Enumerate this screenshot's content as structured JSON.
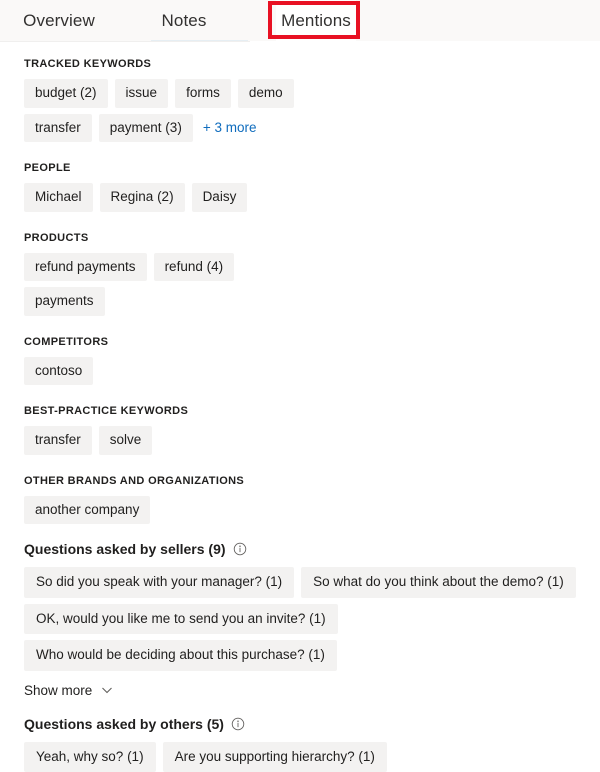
{
  "tabs": [
    {
      "label": "Overview",
      "selected": false
    },
    {
      "label": "Notes",
      "selected": true
    },
    {
      "label": "Mentions",
      "selected": false
    }
  ],
  "annotation": {
    "target": "Mentions",
    "color": "#e81123"
  },
  "colors": {
    "chip_background": "#f3f2f1",
    "link": "#0f6cbd",
    "text": "#201f1e",
    "tabbar_background": "#faf9f8",
    "annotation_red": "#e81123"
  },
  "sections": [
    {
      "title": "TRACKED KEYWORDS",
      "chips": [
        "budget (2)",
        "issue",
        "forms",
        "demo",
        "transfer",
        "payment (3)"
      ],
      "more_link": "+ 3 more"
    },
    {
      "title": "PEOPLE",
      "chips": [
        "Michael",
        "Regina (2)",
        "Daisy"
      ],
      "more_link": null
    },
    {
      "title": "PRODUCTS",
      "chips": [
        "refund payments",
        "refund (4)",
        "payments"
      ],
      "more_link": null
    },
    {
      "title": "COMPETITORS",
      "chips": [
        "contoso"
      ],
      "more_link": null
    },
    {
      "title": "BEST-PRACTICE KEYWORDS",
      "chips": [
        "transfer",
        "solve"
      ],
      "more_link": null
    },
    {
      "title": "OTHER BRANDS AND ORGANIZATIONS",
      "chips": [
        "another company"
      ],
      "more_link": null
    }
  ],
  "questions_sellers": {
    "title": "Questions asked by sellers (9)",
    "info_icon": "info-icon",
    "chips": [
      "So did you speak with your manager? (1)",
      "So what do you think about the demo? (1)",
      "OK, would you like me to send you an invite? (1)",
      "Who would be deciding about this purchase? (1)"
    ],
    "show_more_label": "Show more",
    "chevron_icon": "chevron-down-icon"
  },
  "questions_others": {
    "title": "Questions asked by others (5)",
    "info_icon": "info-icon",
    "chips": [
      "Yeah, why so? (1)",
      "Are you supporting hierarchy? (1)"
    ]
  }
}
